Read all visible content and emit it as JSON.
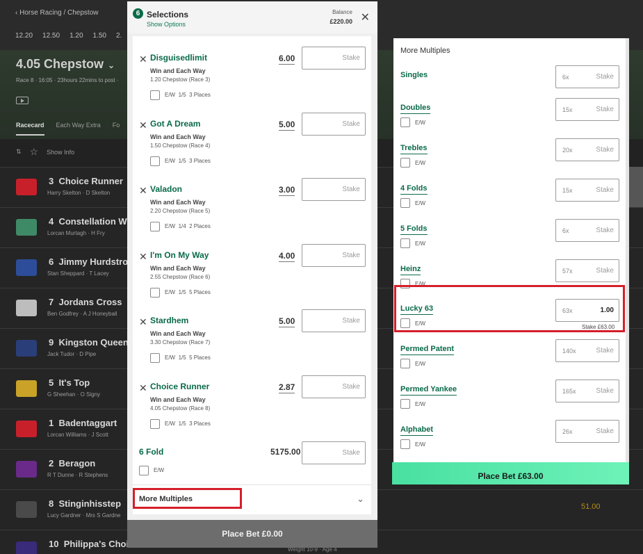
{
  "background": {
    "breadcrumb": "‹ Horse Racing / Chepstow",
    "times": [
      "12.20",
      "12.50",
      "1.20",
      "1.50",
      "2."
    ],
    "race_title": "4.05 Chepstow",
    "race_sub": "Race 8 · 16:05 · 23hours 22mins to post ·",
    "tabs": [
      "Racecard",
      "Each Way Extra",
      "Fo"
    ],
    "show_info": "Show Info",
    "runners": [
      {
        "num": "3",
        "name": "Choice Runner",
        "meta": "Harry Skelton · D Skelton",
        "silk": "#c8202b"
      },
      {
        "num": "4",
        "name": "Constellation W",
        "meta": "Lorcan Murtagh · H Fry",
        "silk": "#3f8a66"
      },
      {
        "num": "6",
        "name": "Jimmy Hurdstro",
        "meta": "Stan Sheppard · T Lacey",
        "silk": "#2d4d9a"
      },
      {
        "num": "7",
        "name": "Jordans Cross",
        "meta": "Ben Godfrey · A J Honeyball",
        "silk": "#bdbdbd"
      },
      {
        "num": "9",
        "name": "Kingston Queen",
        "meta": "Jack Tudor · D Pipe",
        "silk": "#2a3f7a"
      },
      {
        "num": "5",
        "name": "It's Top",
        "meta": "G Sheehan · O Signy",
        "silk": "#c9a227"
      },
      {
        "num": "1",
        "name": "Badentaggart",
        "meta": "Lorcan Williams · J Scott",
        "silk": "#c8202b"
      },
      {
        "num": "2",
        "name": "Beragon",
        "meta": "R T Dunne · R Stephens",
        "silk": "#6a2a8a"
      },
      {
        "num": "8",
        "name": "Stinginhisstep",
        "meta": "Lucy Gardner · Mrs S Gardne",
        "silk": "#4a4a4a"
      },
      {
        "num": "10",
        "name": "Philippa's Choice",
        "meta": "",
        "silk": "#3a2a7a"
      }
    ],
    "odds_row9": "51.00",
    "weight": "Weight 10-9 · Age 4"
  },
  "betslip": {
    "count": "6",
    "title": "Selections",
    "show_options": "Show Options",
    "balance_label": "Balance",
    "balance": "£220.00",
    "stake_placeholder": "Stake",
    "ew_label": "E/W",
    "selections": [
      {
        "name": "Disguisedlimit",
        "odds": "6.00",
        "market": "Win and Each Way",
        "race": "1.20 Chepstow (Race 3)",
        "terms": "1/5  3 Places"
      },
      {
        "name": "Got A Dream",
        "odds": "5.00",
        "market": "Win and Each Way",
        "race": "1.50 Chepstow (Race 4)",
        "terms": "1/5  3 Places"
      },
      {
        "name": "Valadon",
        "odds": "3.00",
        "market": "Win and Each Way",
        "race": "2.20 Chepstow (Race 5)",
        "terms": "1/4  2 Places"
      },
      {
        "name": "I'm On My Way",
        "odds": "4.00",
        "market": "Win and Each Way",
        "race": "2.55 Chepstow (Race 6)",
        "terms": "1/5  5 Places"
      },
      {
        "name": "Stardhem",
        "odds": "5.00",
        "market": "Win and Each Way",
        "race": "3.30 Chepstow (Race 7)",
        "terms": "1/5  5 Places"
      },
      {
        "name": "Choice Runner",
        "odds": "2.87",
        "market": "Win and Each Way",
        "race": "4.05 Chepstow (Race 8)",
        "terms": "1/5  3 Places"
      }
    ],
    "fold_name": "6 Fold",
    "fold_odds": "5175.00",
    "more_multiples": "More Multiples",
    "place_bet": "Place Bet  £0.00"
  },
  "more_multiples": {
    "title": "More Multiples",
    "items": [
      {
        "name": "Singles",
        "count": "6x",
        "stake": "",
        "note": "",
        "ew": false
      },
      {
        "name": "Doubles",
        "count": "15x",
        "stake": "",
        "note": "",
        "ew": true
      },
      {
        "name": "Trebles",
        "count": "20x",
        "stake": "",
        "note": "",
        "ew": true
      },
      {
        "name": "4 Folds",
        "count": "15x",
        "stake": "",
        "note": "",
        "ew": true
      },
      {
        "name": "5 Folds",
        "count": "6x",
        "stake": "",
        "note": "",
        "ew": true
      },
      {
        "name": "Heinz",
        "count": "57x",
        "stake": "",
        "note": "",
        "ew": true
      },
      {
        "name": "Lucky 63",
        "count": "63x",
        "stake": "1.00",
        "note": "Stake £63.00",
        "ew": true
      },
      {
        "name": "Permed Patent",
        "count": "140x",
        "stake": "",
        "note": "",
        "ew": true
      },
      {
        "name": "Permed Yankee",
        "count": "165x",
        "stake": "",
        "note": "",
        "ew": true
      },
      {
        "name": "Alphabet",
        "count": "26x",
        "stake": "",
        "note": "",
        "ew": true
      }
    ],
    "place_bet": "Place Bet  £63.00"
  }
}
